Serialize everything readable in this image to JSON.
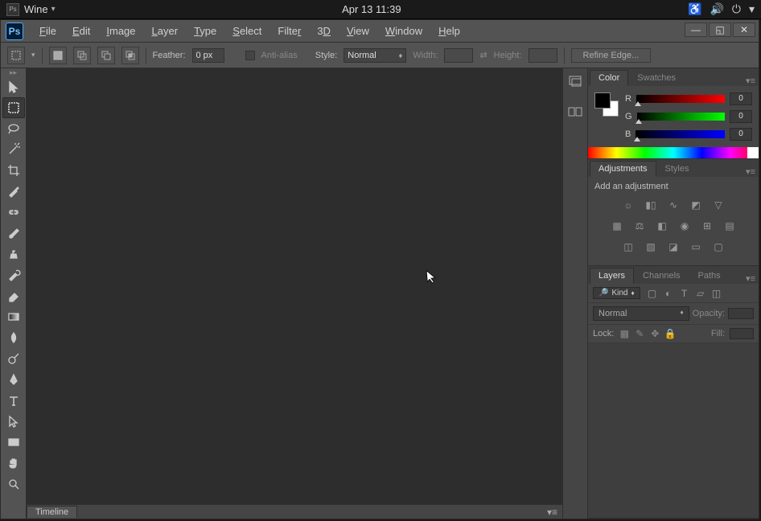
{
  "system": {
    "app_running": "Wine",
    "datetime": "Apr 13  11:39"
  },
  "menubar": {
    "items": [
      "File",
      "Edit",
      "Image",
      "Layer",
      "Type",
      "Select",
      "Filter",
      "3D",
      "View",
      "Window",
      "Help"
    ]
  },
  "options_bar": {
    "feather_label": "Feather:",
    "feather_value": "0 px",
    "antialias_label": "Anti-alias",
    "style_label": "Style:",
    "style_value": "Normal",
    "width_label": "Width:",
    "height_label": "Height:",
    "refine_label": "Refine Edge..."
  },
  "timeline": {
    "tab": "Timeline"
  },
  "panels": {
    "color": {
      "tab1": "Color",
      "tab2": "Swatches",
      "r_label": "R",
      "g_label": "G",
      "b_label": "B",
      "r_value": "0",
      "g_value": "0",
      "b_value": "0"
    },
    "adjustments": {
      "tab1": "Adjustments",
      "tab2": "Styles",
      "label": "Add an adjustment"
    },
    "layers": {
      "tab1": "Layers",
      "tab2": "Channels",
      "tab3": "Paths",
      "kind_label": "Kind",
      "mode": "Normal",
      "opacity_label": "Opacity:",
      "lock_label": "Lock:",
      "fill_label": "Fill:"
    }
  }
}
